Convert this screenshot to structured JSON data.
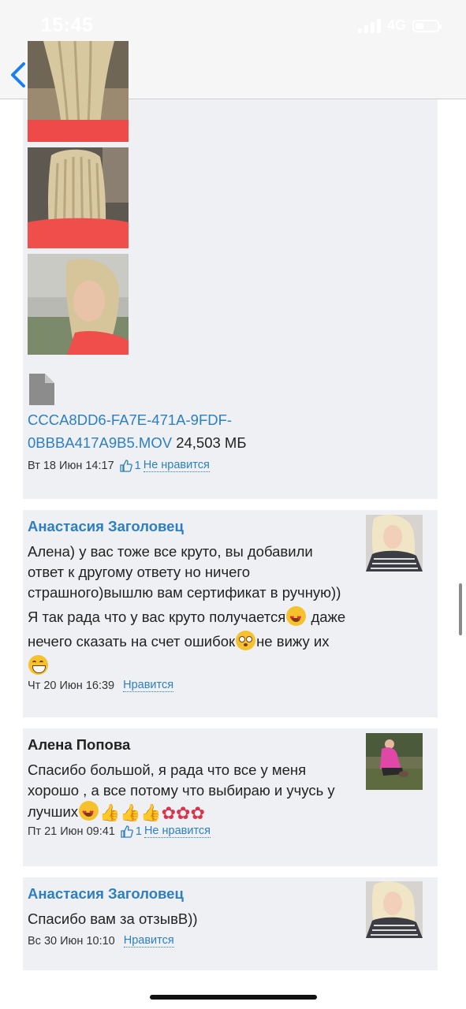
{
  "status_bar": {
    "time": "15:45",
    "network": "4G"
  },
  "nav": {
    "back_label": "back"
  },
  "post1": {
    "file_name_line1": "CCCA8DD6-FA7E-471A-9FDF-",
    "file_name_line2": "0BBBA417A9B5.MOV",
    "file_size": "24,503 МБ",
    "date": "Вт 18 Июн 14:17",
    "like_count": "1",
    "like_label": "Не нравится"
  },
  "comments": [
    {
      "author": "Анастасия Заголовец",
      "text_line1": "Алена) у вас тоже все круто, вы добавили",
      "text_line2": "ответ к другому ответу но ничего",
      "text_line3": "страшного)вышлю вам сертификат в ручную))",
      "text_line4": "Я так рада что у вас круто получается",
      "text_line4b": " даже",
      "text_line5": "нечего сказать на счет ошибок",
      "text_line5b": "не вижу их",
      "date": "Чт 20 Июн 16:39",
      "like_label": "Нравится"
    },
    {
      "author": "Алена Попова",
      "text_line1": "Спасибо большой, я рада что все у меня",
      "text_line2": "хорошо , а все потому что выбираю и учусь у",
      "text_line3": "лучших",
      "date": "Пт 21 Июн 09:41",
      "like_count": "1",
      "like_label": "Не нравится"
    },
    {
      "author": "Анастасия Заголовец",
      "text_line1": "Спасибо вам за отзывВ))",
      "date": "Вс 30 Июн 10:10",
      "like_label": "Нравится"
    }
  ],
  "colors": {
    "link": "#2d7fc0",
    "card_bg": "#eff0f3",
    "nav_bg": "#f6f6f6"
  }
}
